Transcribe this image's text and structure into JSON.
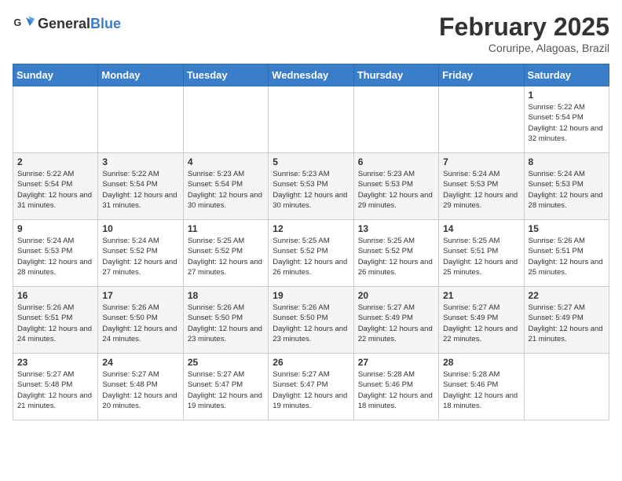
{
  "header": {
    "logo_general": "General",
    "logo_blue": "Blue",
    "month_title": "February 2025",
    "location": "Coruripe, Alagoas, Brazil"
  },
  "weekdays": [
    "Sunday",
    "Monday",
    "Tuesday",
    "Wednesday",
    "Thursday",
    "Friday",
    "Saturday"
  ],
  "weeks": [
    [
      {
        "day": "",
        "info": ""
      },
      {
        "day": "",
        "info": ""
      },
      {
        "day": "",
        "info": ""
      },
      {
        "day": "",
        "info": ""
      },
      {
        "day": "",
        "info": ""
      },
      {
        "day": "",
        "info": ""
      },
      {
        "day": "1",
        "info": "Sunrise: 5:22 AM\nSunset: 5:54 PM\nDaylight: 12 hours and 32 minutes."
      }
    ],
    [
      {
        "day": "2",
        "info": "Sunrise: 5:22 AM\nSunset: 5:54 PM\nDaylight: 12 hours and 31 minutes."
      },
      {
        "day": "3",
        "info": "Sunrise: 5:22 AM\nSunset: 5:54 PM\nDaylight: 12 hours and 31 minutes."
      },
      {
        "day": "4",
        "info": "Sunrise: 5:23 AM\nSunset: 5:54 PM\nDaylight: 12 hours and 30 minutes."
      },
      {
        "day": "5",
        "info": "Sunrise: 5:23 AM\nSunset: 5:53 PM\nDaylight: 12 hours and 30 minutes."
      },
      {
        "day": "6",
        "info": "Sunrise: 5:23 AM\nSunset: 5:53 PM\nDaylight: 12 hours and 29 minutes."
      },
      {
        "day": "7",
        "info": "Sunrise: 5:24 AM\nSunset: 5:53 PM\nDaylight: 12 hours and 29 minutes."
      },
      {
        "day": "8",
        "info": "Sunrise: 5:24 AM\nSunset: 5:53 PM\nDaylight: 12 hours and 28 minutes."
      }
    ],
    [
      {
        "day": "9",
        "info": "Sunrise: 5:24 AM\nSunset: 5:53 PM\nDaylight: 12 hours and 28 minutes."
      },
      {
        "day": "10",
        "info": "Sunrise: 5:24 AM\nSunset: 5:52 PM\nDaylight: 12 hours and 27 minutes."
      },
      {
        "day": "11",
        "info": "Sunrise: 5:25 AM\nSunset: 5:52 PM\nDaylight: 12 hours and 27 minutes."
      },
      {
        "day": "12",
        "info": "Sunrise: 5:25 AM\nSunset: 5:52 PM\nDaylight: 12 hours and 26 minutes."
      },
      {
        "day": "13",
        "info": "Sunrise: 5:25 AM\nSunset: 5:52 PM\nDaylight: 12 hours and 26 minutes."
      },
      {
        "day": "14",
        "info": "Sunrise: 5:25 AM\nSunset: 5:51 PM\nDaylight: 12 hours and 25 minutes."
      },
      {
        "day": "15",
        "info": "Sunrise: 5:26 AM\nSunset: 5:51 PM\nDaylight: 12 hours and 25 minutes."
      }
    ],
    [
      {
        "day": "16",
        "info": "Sunrise: 5:26 AM\nSunset: 5:51 PM\nDaylight: 12 hours and 24 minutes."
      },
      {
        "day": "17",
        "info": "Sunrise: 5:26 AM\nSunset: 5:50 PM\nDaylight: 12 hours and 24 minutes."
      },
      {
        "day": "18",
        "info": "Sunrise: 5:26 AM\nSunset: 5:50 PM\nDaylight: 12 hours and 23 minutes."
      },
      {
        "day": "19",
        "info": "Sunrise: 5:26 AM\nSunset: 5:50 PM\nDaylight: 12 hours and 23 minutes."
      },
      {
        "day": "20",
        "info": "Sunrise: 5:27 AM\nSunset: 5:49 PM\nDaylight: 12 hours and 22 minutes."
      },
      {
        "day": "21",
        "info": "Sunrise: 5:27 AM\nSunset: 5:49 PM\nDaylight: 12 hours and 22 minutes."
      },
      {
        "day": "22",
        "info": "Sunrise: 5:27 AM\nSunset: 5:49 PM\nDaylight: 12 hours and 21 minutes."
      }
    ],
    [
      {
        "day": "23",
        "info": "Sunrise: 5:27 AM\nSunset: 5:48 PM\nDaylight: 12 hours and 21 minutes."
      },
      {
        "day": "24",
        "info": "Sunrise: 5:27 AM\nSunset: 5:48 PM\nDaylight: 12 hours and 20 minutes."
      },
      {
        "day": "25",
        "info": "Sunrise: 5:27 AM\nSunset: 5:47 PM\nDaylight: 12 hours and 19 minutes."
      },
      {
        "day": "26",
        "info": "Sunrise: 5:27 AM\nSunset: 5:47 PM\nDaylight: 12 hours and 19 minutes."
      },
      {
        "day": "27",
        "info": "Sunrise: 5:28 AM\nSunset: 5:46 PM\nDaylight: 12 hours and 18 minutes."
      },
      {
        "day": "28",
        "info": "Sunrise: 5:28 AM\nSunset: 5:46 PM\nDaylight: 12 hours and 18 minutes."
      },
      {
        "day": "",
        "info": ""
      }
    ]
  ]
}
